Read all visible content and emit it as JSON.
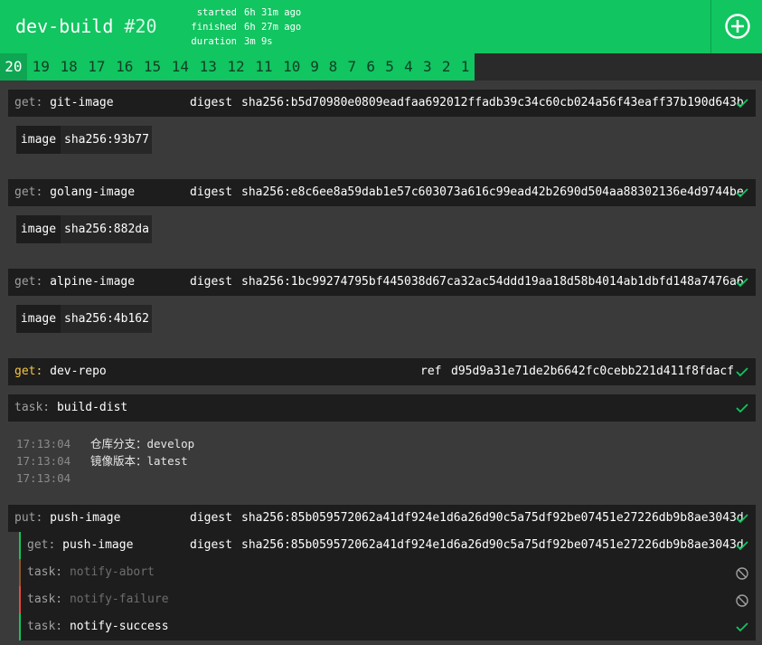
{
  "header": {
    "pipeline_name": "dev-build",
    "build_number": "#20",
    "meta": [
      {
        "key": "started",
        "value": "6h 31m ago"
      },
      {
        "key": "finished",
        "value": "6h 27m ago"
      },
      {
        "key": "duration",
        "value": "3m 9s"
      }
    ],
    "add_icon": "plus-circle-icon"
  },
  "builds": [
    "20",
    "19",
    "18",
    "17",
    "16",
    "15",
    "14",
    "13",
    "12",
    "11",
    "10",
    "9",
    "8",
    "7",
    "6",
    "5",
    "4",
    "3",
    "2",
    "1"
  ],
  "steps": {
    "git_image": {
      "type": "get:",
      "name": "git-image",
      "key": "digest",
      "value": "sha256:b5d70980e0809eadfaa692012ffadb39c34c60cb024a56f43eaff37b190d643b",
      "version_key": "image",
      "version_value": "sha256:93b77"
    },
    "golang_image": {
      "type": "get:",
      "name": "golang-image",
      "key": "digest",
      "value": "sha256:e8c6ee8a59dab1e57c603073a616c99ead42b2690d504aa88302136e4d9744be",
      "version_key": "image",
      "version_value": "sha256:882da"
    },
    "alpine_image": {
      "type": "get:",
      "name": "alpine-image",
      "key": "digest",
      "value": "sha256:1bc99274795bf445038d67ca32ac54ddd19aa18d58b4014ab1dbfd148a7476a6",
      "version_key": "image",
      "version_value": "sha256:4b162"
    },
    "dev_repo": {
      "type": "get:",
      "name": "dev-repo",
      "key": "ref",
      "value": "d95d9a31e71de2b6642fc0cebb221d411f8fdacf"
    },
    "build_dist": {
      "type": "task:",
      "name": "build-dist"
    },
    "push_image": {
      "type": "put:",
      "name": "push-image",
      "key": "digest",
      "value": "sha256:85b059572062a41df924e1d6a26d90c5a75df92be07451e27226db9b8ae3043d"
    }
  },
  "log": [
    {
      "time": "17:13:04",
      "text": "仓库分支：develop"
    },
    {
      "time": "17:13:04",
      "text": "镜像版本：latest"
    },
    {
      "time": "17:13:04",
      "text": ""
    }
  ],
  "hooks": {
    "get_push_image": {
      "type": "get:",
      "name": "push-image",
      "key": "digest",
      "value": "sha256:85b059572062a41df924e1d6a26d90c5a75df92be07451e27226db9b8ae3043d"
    },
    "notify_abort": {
      "type": "task:",
      "name": "notify-abort"
    },
    "notify_failure": {
      "type": "task:",
      "name": "notify-failure"
    },
    "notify_success": {
      "type": "task:",
      "name": "notify-success"
    }
  },
  "colors": {
    "success": "#11c560",
    "failure": "#e74c3c",
    "abort": "#8b572a",
    "yellow": "#f5c542"
  }
}
